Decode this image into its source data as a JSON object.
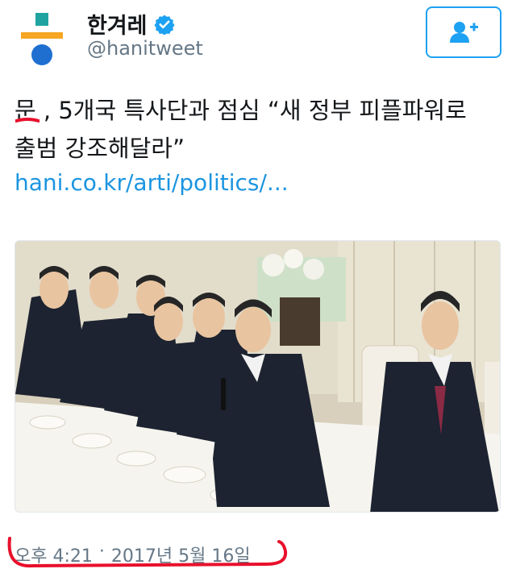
{
  "account": {
    "display_name": "한겨레",
    "handle": "@hanitweet",
    "verified": true,
    "brand_colors": {
      "teal": "#1fa3a0",
      "orange": "#f5a623",
      "blue": "#1f6fd1"
    }
  },
  "follow_button": {
    "icon": "add-user-icon",
    "color": "#1da1f2"
  },
  "tweet": {
    "text_moon": "문",
    "text_line1_rest": ", 5개국 특사단과 점심 “새 정부 피플파워로",
    "text_line2": "출범 강조해달라”",
    "link": "hani.co.kr/arti/politics/...",
    "link_color": "#1b95e0",
    "annotation_color": "#e8102c"
  },
  "photo": {
    "icon": "press-photo-luncheon"
  },
  "timestamp": {
    "time": "오후 4:21",
    "separator": "·",
    "date": "2017년 5월 16일"
  }
}
